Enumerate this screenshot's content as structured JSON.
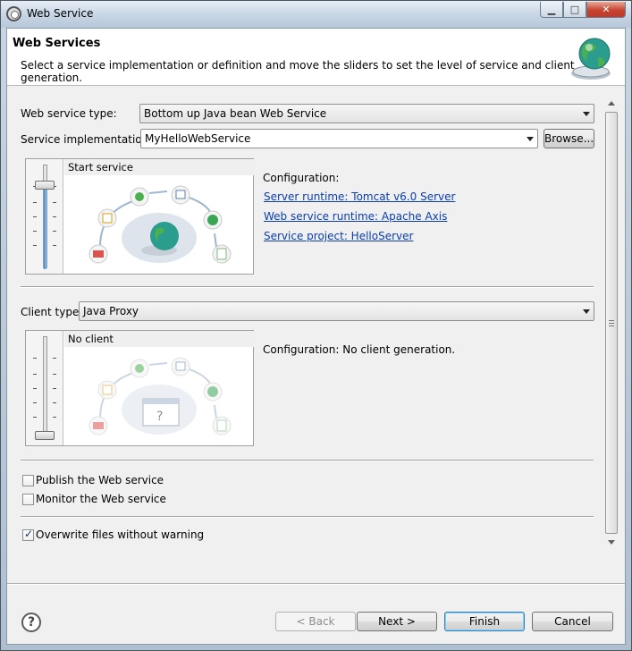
{
  "window": {
    "title": "Web Service"
  },
  "banner": {
    "title": "Web Services",
    "description": "Select a service implementation or definition and move the sliders to set the level of service and client generation."
  },
  "service": {
    "type_label": "Web service type:",
    "type_value": "Bottom up Java bean Web Service",
    "impl_label": "Service implementation:",
    "impl_value": "MyHelloWebService",
    "browse_label": "Browse...",
    "slider_caption": "Start service",
    "slider_level": 0.83,
    "config_heading": "Configuration:",
    "links": [
      "Server runtime: Tomcat v6.0 Server",
      "Web service runtime: Apache Axis",
      "Service project: HelloServer"
    ]
  },
  "client": {
    "type_label": "Client type:",
    "type_value": "Java Proxy",
    "slider_caption": "No client",
    "slider_level": 0.0,
    "config_text": "Configuration: No client generation."
  },
  "options": {
    "publish": {
      "label": "Publish the Web service",
      "checked": false
    },
    "monitor": {
      "label": "Monitor the Web service",
      "checked": false
    },
    "overwrite": {
      "label": "Overwrite files without warning",
      "checked": true
    }
  },
  "buttons": {
    "back": "< Back",
    "next": "Next >",
    "finish": "Finish",
    "cancel": "Cancel"
  },
  "colors": {
    "link": "#0b3eaf",
    "slider_fill": "#3b8ad6",
    "title_bar": "#c8d6e5",
    "close_button": "#c7442f"
  }
}
